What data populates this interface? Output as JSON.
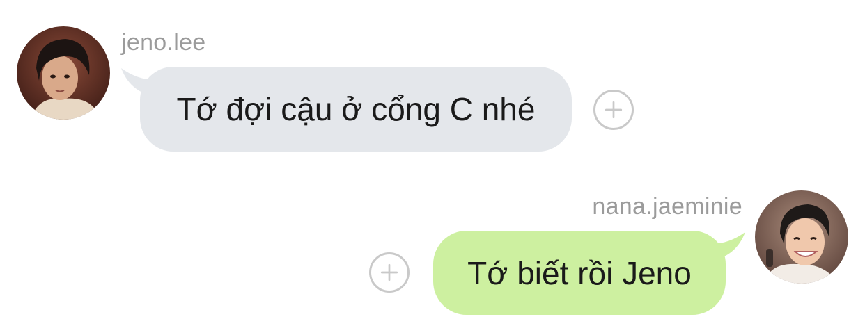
{
  "messages": [
    {
      "username": "jeno.lee",
      "text": "Tớ đợi cậu ở cổng C nhé",
      "avatar": "avatar-jeno",
      "bubble_color": "#e4e7eb"
    },
    {
      "username": "nana.jaeminie",
      "text": "Tớ biết rồi Jeno",
      "avatar": "avatar-jaemin",
      "bubble_color": "#cdf0a0"
    }
  ],
  "reaction_icon": "plus-circle-icon"
}
